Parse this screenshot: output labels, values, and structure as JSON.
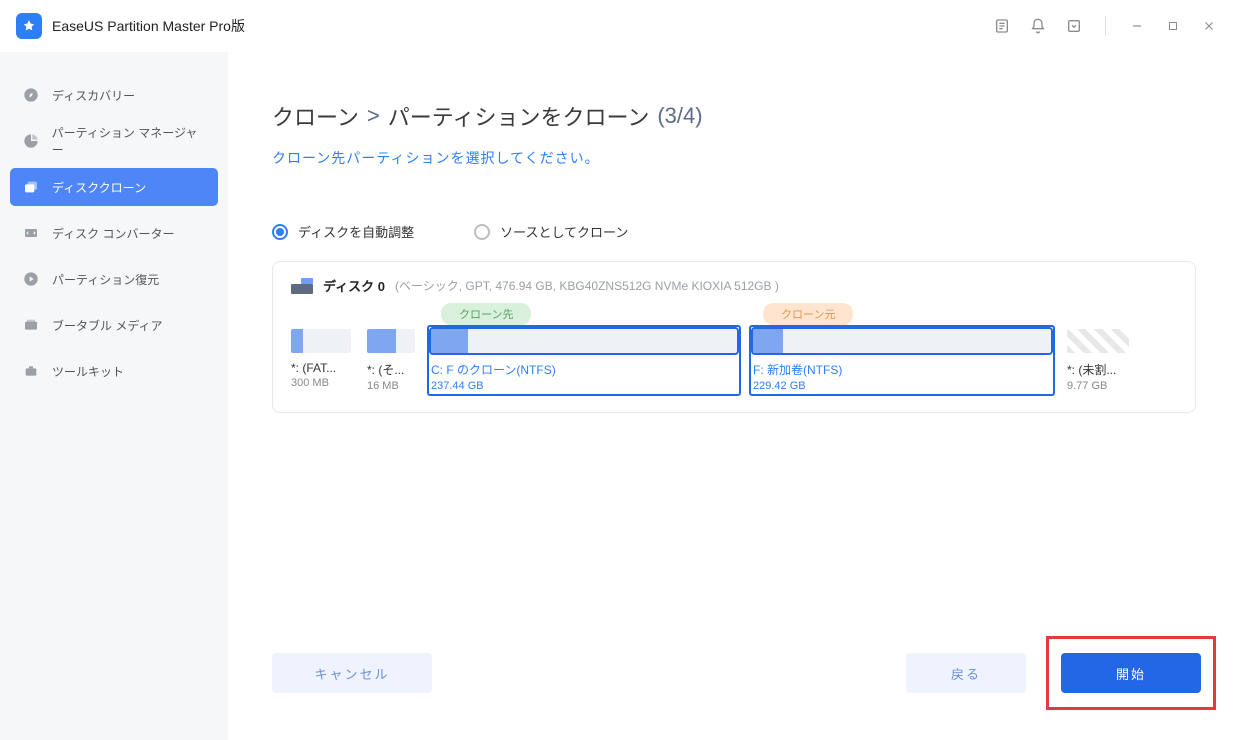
{
  "titlebar": {
    "app_title": "EaseUS Partition Master Pro版"
  },
  "sidebar": {
    "items": [
      {
        "label": "ディスカバリー"
      },
      {
        "label": "パーティション マネージャー"
      },
      {
        "label": "ディスククローン"
      },
      {
        "label": "ディスク コンバーター"
      },
      {
        "label": "パーティション復元"
      },
      {
        "label": "ブータブル メディア"
      },
      {
        "label": "ツールキット"
      }
    ]
  },
  "crumb": {
    "root": "クローン",
    "sep": ">",
    "page": "パーティションをクローン",
    "step": "(3/4)"
  },
  "subtitle": "クローン先パーティションを選択してください。",
  "radios": {
    "auto": "ディスクを自動調整",
    "source": "ソースとしてクローン"
  },
  "disk": {
    "name": "ディスク 0",
    "meta": "(ベーシック, GPT, 476.94 GB, KBG40ZNS512G NVMe KIOXIA 512GB )"
  },
  "badges": {
    "dst": "クローン先",
    "src": "クローン元"
  },
  "parts": [
    {
      "label": "*: (FAT...",
      "size": "300 MB"
    },
    {
      "label": "*: (そ...",
      "size": "16 MB"
    },
    {
      "label": "C: F のクローン(NTFS)",
      "size": "237.44 GB"
    },
    {
      "label": "F: 新加卷(NTFS)",
      "size": "229.42 GB"
    },
    {
      "label": "*: (未割...",
      "size": "9.77 GB"
    }
  ],
  "buttons": {
    "cancel": "キャンセル",
    "back": "戻る",
    "start": "開始"
  }
}
